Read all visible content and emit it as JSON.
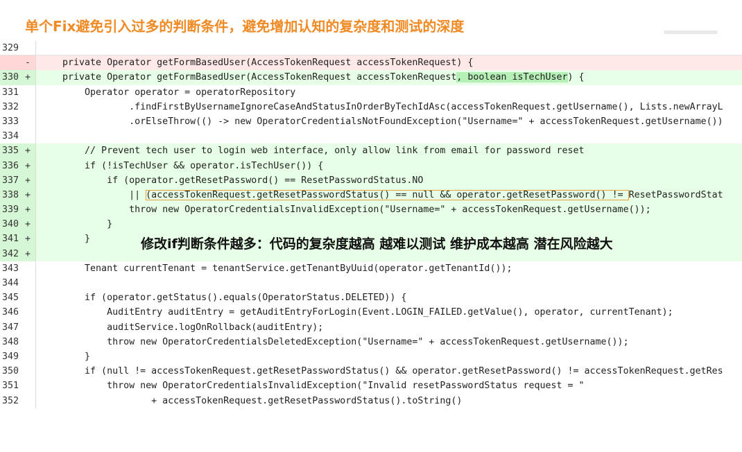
{
  "headline": "单个Fix避免引入过多的判断条件，避免增加认知的复杂度和测试的深度",
  "overlay_note": "修改if判断条件越多：代码的复杂度越高 越难以测试 维护成本越高  潜在风险越大",
  "diff": {
    "l329": {
      "num": "329",
      "marker": "",
      "text": ""
    },
    "del": {
      "num": "",
      "marker": "-",
      "text": "    private Operator getFormBasedUser(AccessTokenRequest accessTokenRequest) {"
    },
    "l330": {
      "num": "330",
      "marker": "+",
      "pre": "    private Operator getFormBasedUser(AccessTokenRequest accessTokenRequest",
      "hl": ", boolean isTechUser",
      "post": ") {"
    },
    "l331": {
      "num": "331",
      "marker": "",
      "text": "        Operator operator = operatorRepository"
    },
    "l332": {
      "num": "332",
      "marker": "",
      "text": "                .findFirstByUsernameIgnoreCaseAndStatusInOrderByTechIdAsc(accessTokenRequest.getUsername(), Lists.newArrayL"
    },
    "l333": {
      "num": "333",
      "marker": "",
      "text": "                .orElseThrow(() -> new OperatorCredentialsNotFoundException(\"Username=\" + accessTokenRequest.getUsername())"
    },
    "l334": {
      "num": "334",
      "marker": "",
      "text": ""
    },
    "l335": {
      "num": "335",
      "marker": "+",
      "text": "        // Prevent tech user to login web interface, only allow link from email for password reset"
    },
    "l336": {
      "num": "336",
      "marker": "+",
      "text": "        if (!isTechUser && operator.isTechUser()) {"
    },
    "l337": {
      "num": "337",
      "marker": "+",
      "text": "            if (operator.getResetPassword() == ResetPasswordStatus.NO"
    },
    "l338": {
      "num": "338",
      "marker": "+",
      "pre": "                || ",
      "boxed": "(accessTokenRequest.getResetPasswordStatus() == null && operator.getResetPassword() != ",
      "post": "ResetPasswordStat"
    },
    "l339": {
      "num": "339",
      "marker": "+",
      "text": "                throw new OperatorCredentialsInvalidException(\"Username=\" + accessTokenRequest.getUsername());"
    },
    "l340": {
      "num": "340",
      "marker": "+",
      "text": "            }"
    },
    "l341": {
      "num": "341",
      "marker": "+",
      "text": "        }"
    },
    "l342": {
      "num": "342",
      "marker": "+",
      "text": ""
    },
    "l343": {
      "num": "343",
      "marker": "",
      "text": "        Tenant currentTenant = tenantService.getTenantByUuid(operator.getTenantId());"
    },
    "l344": {
      "num": "344",
      "marker": "",
      "text": ""
    },
    "l345": {
      "num": "345",
      "marker": "",
      "text": "        if (operator.getStatus().equals(OperatorStatus.DELETED)) {"
    },
    "l346": {
      "num": "346",
      "marker": "",
      "text": "            AuditEntry auditEntry = getAuditEntryForLogin(Event.LOGIN_FAILED.getValue(), operator, currentTenant);"
    },
    "l347": {
      "num": "347",
      "marker": "",
      "text": "            auditService.logOnRollback(auditEntry);"
    },
    "l348": {
      "num": "348",
      "marker": "",
      "text": "            throw new OperatorCredentialsDeletedException(\"Username=\" + accessTokenRequest.getUsername());"
    },
    "l349": {
      "num": "349",
      "marker": "",
      "text": "        }"
    },
    "l350": {
      "num": "350",
      "marker": "",
      "text": "        if (null != accessTokenRequest.getResetPasswordStatus() && operator.getResetPassword() != accessTokenRequest.getRes"
    },
    "l351": {
      "num": "351",
      "marker": "",
      "text": "            throw new OperatorCredentialsInvalidException(\"Invalid resetPasswordStatus request = \""
    },
    "l352": {
      "num": "352",
      "marker": "",
      "text": "                    + accessTokenRequest.getResetPasswordStatus().toString()"
    }
  }
}
